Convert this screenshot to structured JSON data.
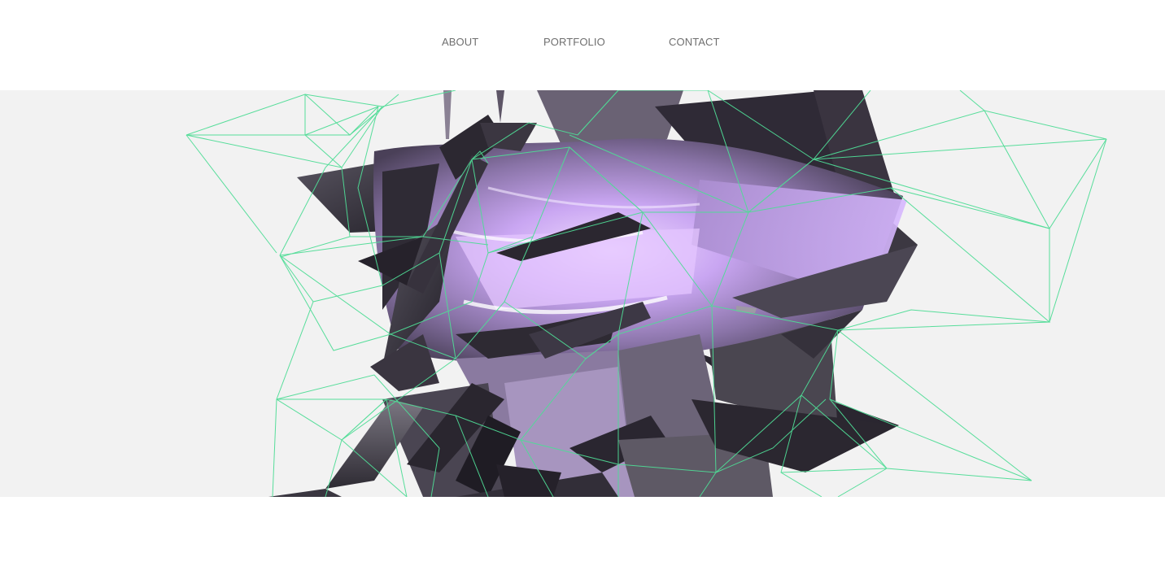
{
  "nav": {
    "items": [
      {
        "label": "ABOUT"
      },
      {
        "label": "PORTFOLIO"
      },
      {
        "label": "CONTACT"
      }
    ]
  },
  "hero": {
    "artwork": "3d-low-poly-sculpture",
    "colors": {
      "background": "#f2f2f2",
      "wireframe": "#4fdc96",
      "glow": "#e6c9ff",
      "shadow": "#2b2630"
    }
  }
}
